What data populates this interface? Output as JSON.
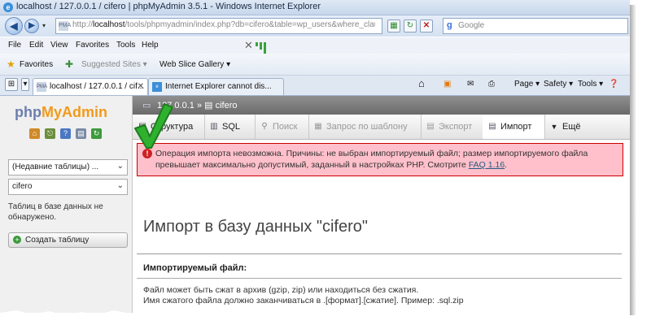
{
  "window": {
    "title": "localhost / 127.0.0.1 / cifero | phpMyAdmin 3.5.1 - Windows Internet Explorer"
  },
  "address_bar": {
    "url_prefix": "http://",
    "url_host": "localhost",
    "url_rest": "/tools/phpmyadmin/index.php?db=cifero&table=wp_users&where_clause=%60wp_",
    "search_placeholder": "Google"
  },
  "menu_bar": [
    "File",
    "Edit",
    "View",
    "Favorites",
    "Tools",
    "Help"
  ],
  "favorites_bar": {
    "favorites_label": "Favorites",
    "suggested_sites": "Suggested Sites ▾",
    "web_slice_gallery": "Web Slice Gallery ▾"
  },
  "browser_tabs": [
    {
      "label": "localhost / 127.0.0.1 / cif...",
      "active": true
    },
    {
      "label": "Internet Explorer cannot dis...",
      "active": false
    }
  ],
  "command_bar": {
    "page": "Page ▾",
    "safety": "Safety ▾",
    "tools": "Tools ▾"
  },
  "sidebar": {
    "logo_php": "php",
    "logo_myadmin": "MyAdmin",
    "recent_tables": "(Недавние таблицы) ...",
    "database": "cifero",
    "no_tables_text": "Таблиц в базе данных не обнаружено.",
    "create_table": "Создать таблицу"
  },
  "breadcrumb": {
    "server": "127.0.0.1",
    "separator": "»",
    "database": "cifero"
  },
  "pma_tabs": [
    {
      "label": "Структура",
      "icon": "structure-icon",
      "state": "normal"
    },
    {
      "label": "SQL",
      "icon": "sql-icon",
      "state": "normal"
    },
    {
      "label": "Поиск",
      "icon": "search-icon",
      "state": "dim"
    },
    {
      "label": "Запрос по шаблону",
      "icon": "query-icon",
      "state": "dim"
    },
    {
      "label": "Экспорт",
      "icon": "export-icon",
      "state": "dim"
    },
    {
      "label": "Импорт",
      "icon": "import-icon",
      "state": "active"
    },
    {
      "label": "Ещё",
      "icon": "more-icon",
      "state": "normal"
    }
  ],
  "error": {
    "text": "Операция импорта невозможна. Причины: не выбран импортируемый файл; размер импортируемого файла превышает максимально допустимый, заданный в настройках PHP. Смотрите ",
    "link": "FAQ 1.16",
    "tail": "."
  },
  "main": {
    "heading": "Импорт в базу данных \"cifero\"",
    "fieldset_title": "Импортируемый файл:",
    "line1": "Файл может быть сжат в архив (gzip, zip) или находиться без сжатия.",
    "line2": "Имя сжатого файла должно заканчиваться в .[формат].[сжатие]. Пример: .sql.zip"
  },
  "colors": {
    "error_bg": "#ffc0cb",
    "error_border": "#cc0000",
    "checkmark": "#2fb12f",
    "logo_blue": "#6c7eae",
    "logo_orange": "#f29a1a"
  }
}
